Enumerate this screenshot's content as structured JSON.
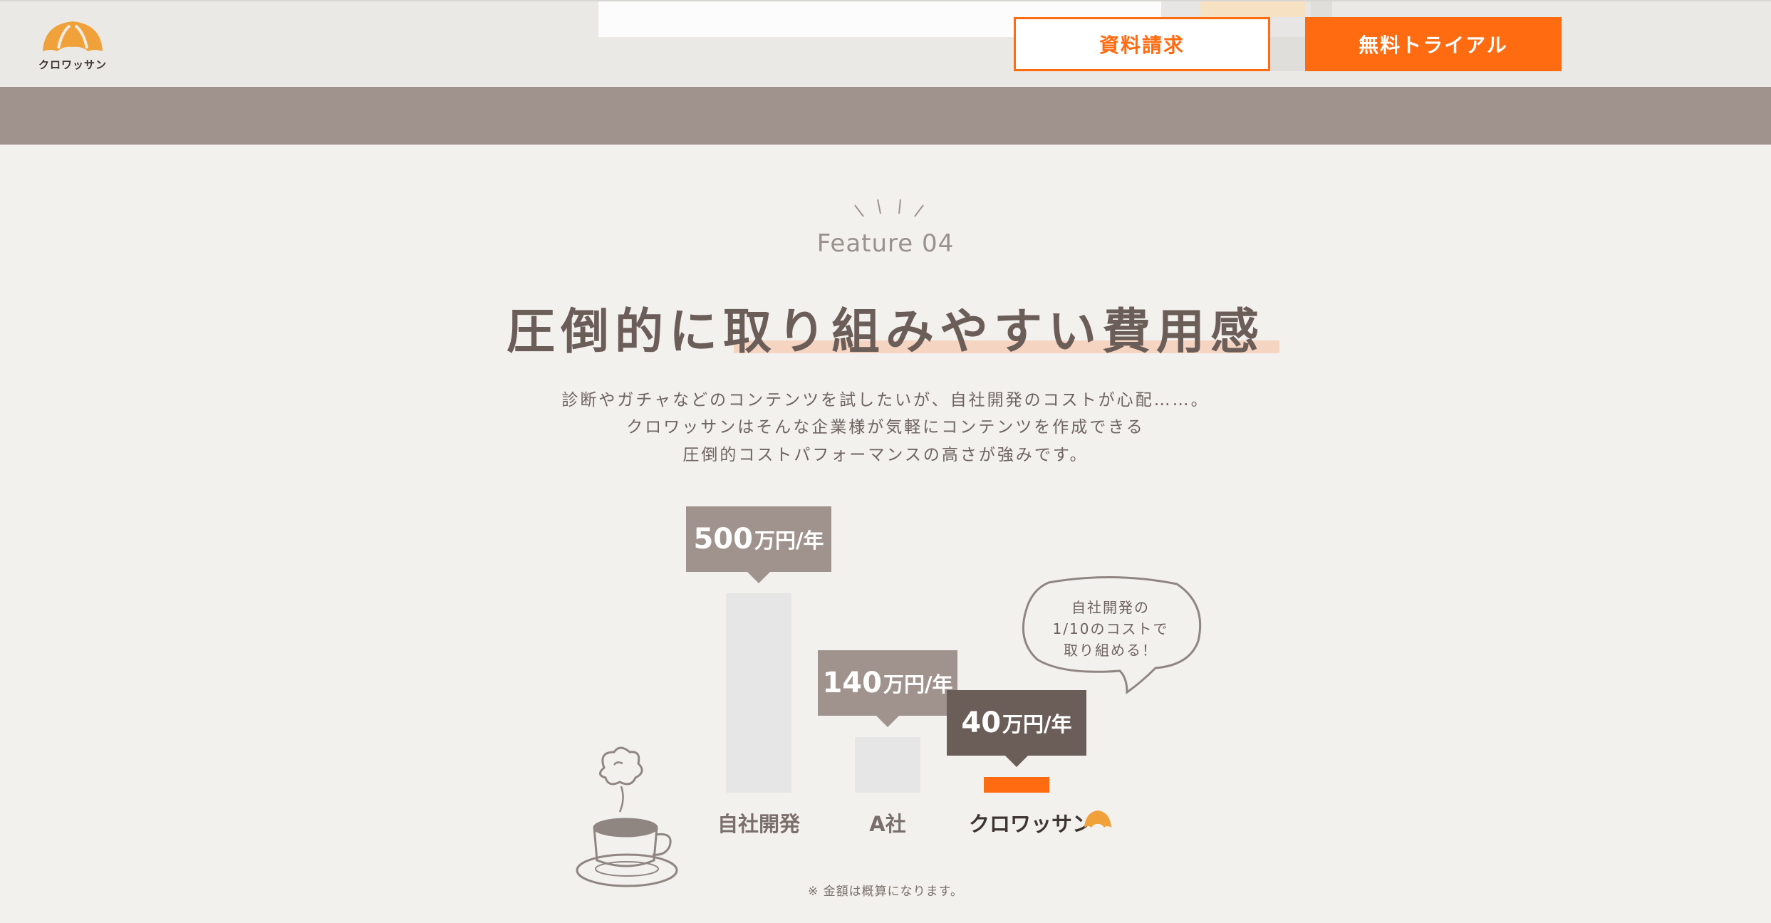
{
  "header": {
    "logo_text": "クロワッサン",
    "doc_button": "資料請求",
    "trial_button": "無料トライアル"
  },
  "section": {
    "eyebrow": "Feature 04",
    "title": "圧倒的に取り組みやすい費用感",
    "description": [
      "診断やガチャなどのコンテンツを試したいが、自社開発のコストが心配……。",
      "クロワッサンはそんな企業様が気軽にコンテンツを作成できる",
      "圧倒的コストパフォーマンスの高さが強みです。"
    ],
    "bubble_lines": [
      "自社開発の",
      "1/10のコストで",
      "取り組める！"
    ],
    "note": "※ 金額は概算になります。"
  },
  "colors": {
    "accent": "#ff6b10",
    "bar_default": "#e6e6e6",
    "tag_default": "#a0938d",
    "tag_highlight": "#6b5d58"
  },
  "chart_data": {
    "type": "bar",
    "categories": [
      "自社開発",
      "A社",
      "クロワッサン"
    ],
    "values": [
      500,
      140,
      40
    ],
    "value_labels": [
      {
        "num": "500",
        "unit": "万円/年"
      },
      {
        "num": "140",
        "unit": "万円/年"
      },
      {
        "num": "40",
        "unit": "万円/年"
      }
    ],
    "ylim": [
      0,
      500
    ],
    "grid": false,
    "legend": "none",
    "highlight_category": "クロワッサン"
  }
}
